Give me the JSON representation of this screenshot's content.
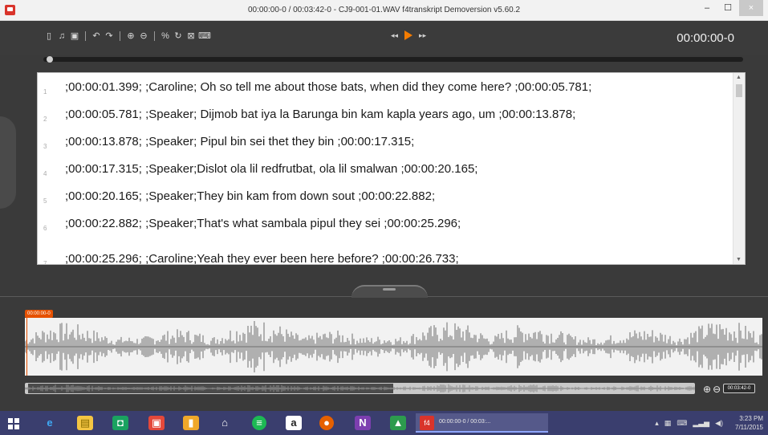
{
  "window": {
    "title": "00:00:00-0 / 00:03:42-0 - CJ9-001-01.WAV f4transkript Demoversion v5.60.2",
    "min": "–",
    "max": "☐",
    "close": "×"
  },
  "toolbar": {
    "icons": [
      "doc-icon",
      "music-icon",
      "save-icon",
      "undo-icon",
      "redo-icon",
      "zoom-in-icon",
      "zoom-out-icon",
      "link-icon",
      "refresh-icon",
      "window-icon",
      "keyboard-icon"
    ],
    "rewind": "◂◂",
    "fast_forward": "▸▸",
    "time": "00:00:00-0"
  },
  "transcript": {
    "rows": [
      {
        "num": "1",
        "text": ";00:00:01.399; ;Caroline; Oh so tell me about those bats, when did they come here? ;00:00:05.781;"
      },
      {
        "num": "2",
        "text": ";00:00:05.781; ;Speaker; Dijmob bat iya la Barunga bin kam kapla years ago, um ;00:00:13.878;"
      },
      {
        "num": "3",
        "text": ";00:00:13.878; ;Speaker; Pipul bin sei thet they bin ;00:00:17.315;"
      },
      {
        "num": "4",
        "text": ";00:00:17.315; ;Speaker;Dislot ola lil redfrutbat, ola lil smalwan ;00:00:20.165;"
      },
      {
        "num": "5",
        "text": ";00:00:20.165; ;Speaker;They bin kam from down sout ;00:00:22.882;"
      },
      {
        "num": "6",
        "text": ";00:00:22.882; ;Speaker;That's what sambala pipul they sei ;00:00:25.296;"
      },
      {
        "num": "7",
        "text": ";00:00:25.296; ;Caroline;Yeah they ever been here before? ;00:00:26.733;"
      }
    ]
  },
  "waveform": {
    "cursor_time": "00:00:00-0",
    "duration": "00:03:42-0",
    "zoom_in": "⊕",
    "zoom_out": "⊖"
  },
  "taskbar": {
    "active_label": "00:00:00-0 / 00:03:...",
    "active_icon": "f4",
    "apps": [
      "ie-icon",
      "file-explorer-icon",
      "store-icon",
      "photos-icon",
      "notes-icon",
      "home-icon",
      "spotify-icon",
      "amazon-icon",
      "firefox-icon",
      "onenote-icon",
      "gallery-icon"
    ],
    "time": "3:23 PM",
    "date": "7/11/2015"
  },
  "colors": {
    "accent": "#f57c00",
    "panel_bg": "#3a3a3a",
    "taskbar_bg": "#3a3e6e"
  }
}
